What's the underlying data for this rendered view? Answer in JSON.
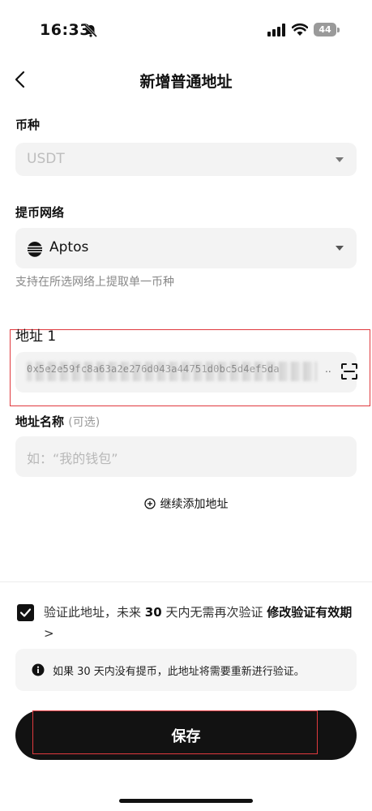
{
  "status_bar": {
    "time": "16:33",
    "battery": "44"
  },
  "header": {
    "title": "新增普通地址"
  },
  "currency": {
    "label": "币种",
    "value": "USDT"
  },
  "network": {
    "label": "提币网络",
    "value": "Aptos",
    "hint": "支持在所选网络上提取单一币种"
  },
  "address": {
    "label": "地址 1",
    "value": "0x5e2e59fc8a63a2e276d043a44751d0bc5d4ef5da",
    "ellipsis": ".."
  },
  "address_name": {
    "label": "地址名称",
    "optional": "(可选)",
    "placeholder": "如：“我的钱包”"
  },
  "add_more": {
    "label": "继续添加地址"
  },
  "verify": {
    "text_before": "验证此地址，未来",
    "days": "30",
    "text_after": "天内无需再次验证",
    "link": "修改验证有效期",
    "chevron": ">"
  },
  "info": {
    "text": "如果 30 天内没有提币，此地址将需要重新进行验证。"
  },
  "save_button": {
    "label": "保存"
  },
  "colors": {
    "primary": "#121212",
    "highlight_border": "#e0393e",
    "field_bg": "#f3f3f3"
  }
}
